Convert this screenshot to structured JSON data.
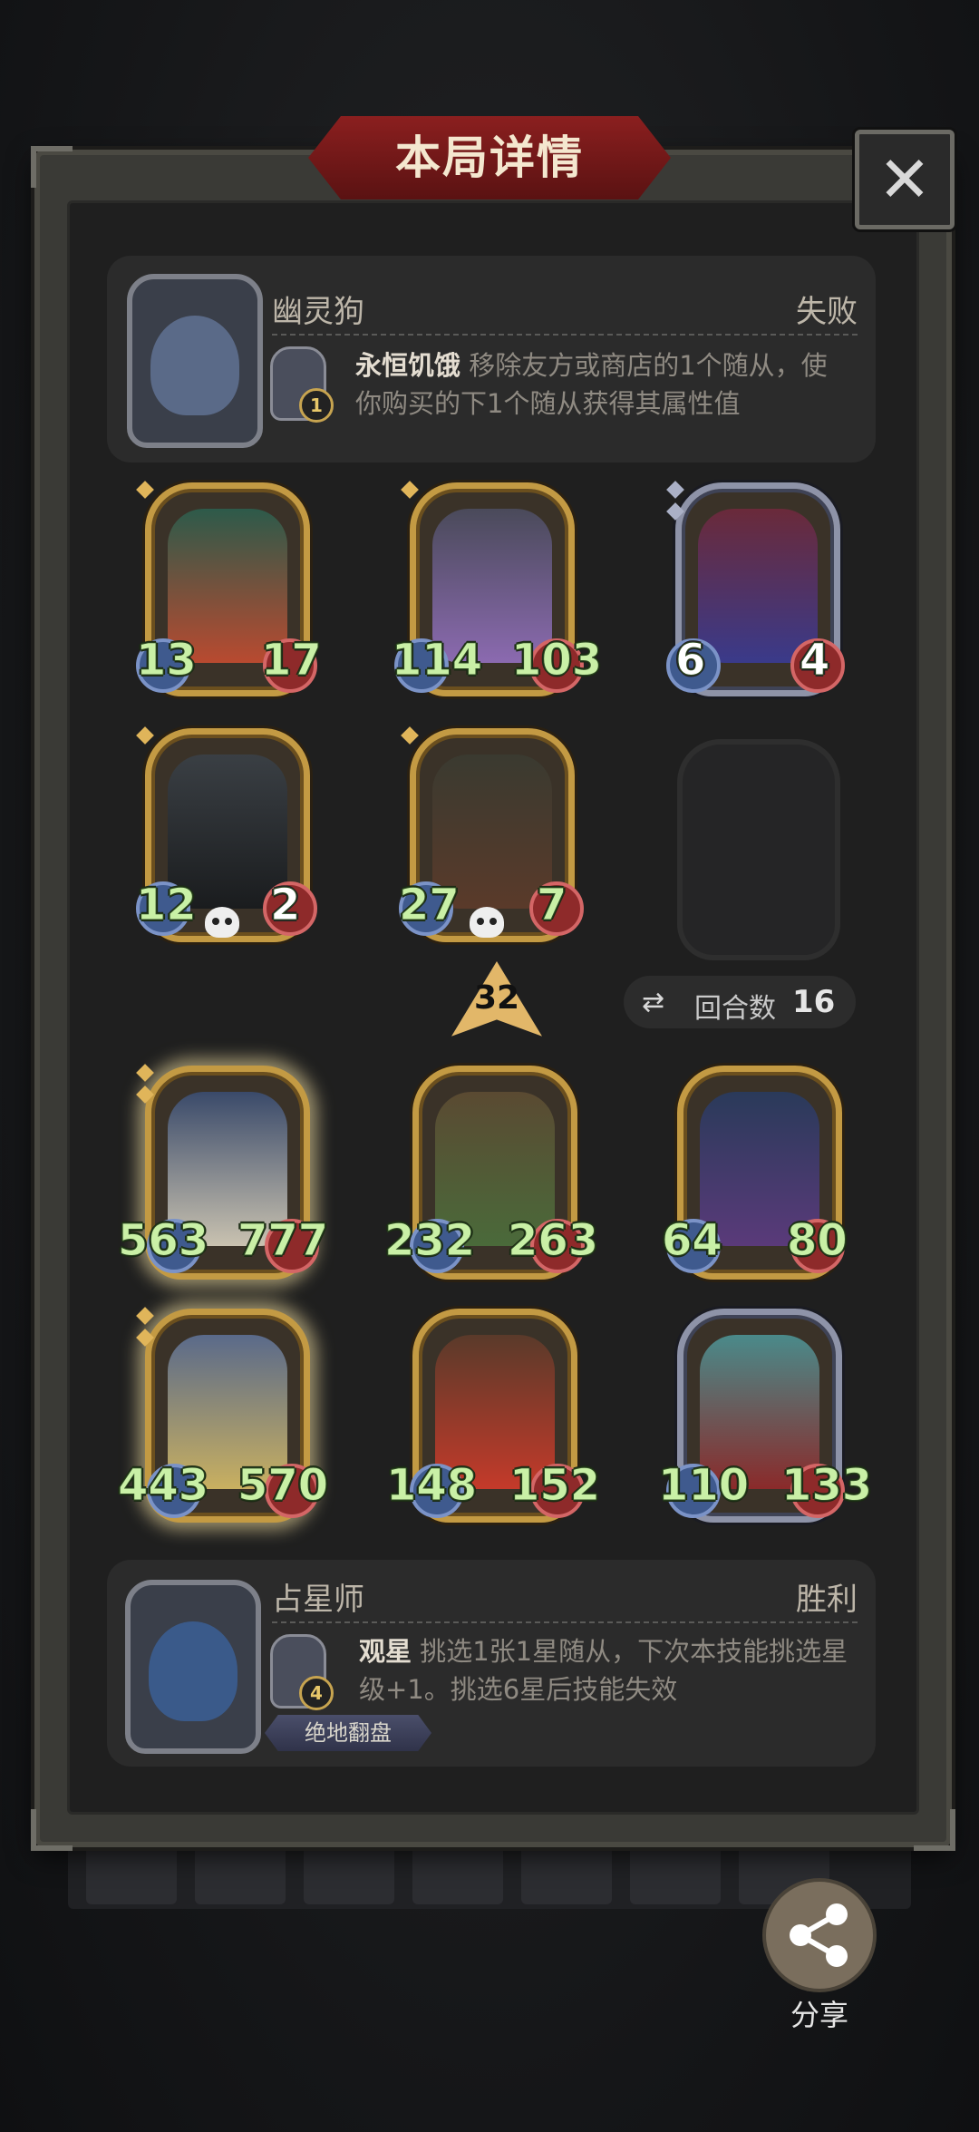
{
  "header": {
    "title": "本局详情",
    "close_icon": "close-icon"
  },
  "opponent": {
    "name": "幽灵狗",
    "result": "失败",
    "skill_level": "1",
    "skill_name": "永恒饥饿",
    "skill_desc_line1": " 移除友方或商店的1个随从，使",
    "skill_desc_line2": "你购买的下1个随从获得其属性值"
  },
  "opponent_board": [
    {
      "attack": "13",
      "health": "17",
      "frame": "gold",
      "dead": false
    },
    {
      "attack": "114",
      "health": "103",
      "frame": "gold",
      "dead": false
    },
    {
      "attack": "6",
      "health": "4",
      "frame": "silver",
      "dead": false,
      "white_stats": true
    },
    {
      "attack": "12",
      "health": "2",
      "frame": "gold",
      "dead": true
    },
    {
      "attack": "27",
      "health": "7",
      "frame": "gold",
      "dead": true
    }
  ],
  "tier": {
    "value": "32"
  },
  "rounds": {
    "label": "回合数",
    "value": "16",
    "icon": "refresh-icon"
  },
  "player_board": [
    {
      "attack": "563",
      "health": "777",
      "frame": "gold",
      "glow": true
    },
    {
      "attack": "232",
      "health": "263",
      "frame": "gold",
      "glow": false
    },
    {
      "attack": "64",
      "health": "80",
      "frame": "gold",
      "glow": false
    },
    {
      "attack": "443",
      "health": "570",
      "frame": "gold",
      "glow": true
    },
    {
      "attack": "148",
      "health": "152",
      "frame": "gold",
      "glow": false
    },
    {
      "attack": "110",
      "health": "133",
      "frame": "silver",
      "glow": false
    }
  ],
  "player": {
    "name": "占星师",
    "result": "胜利",
    "skill_level": "4",
    "skill_name": "观星",
    "skill_desc_line1": " 挑选1张1星随从，下次本技能挑选星",
    "skill_desc_line2": "级+1。挑选6星后技能失效",
    "badge": "绝地翻盘"
  },
  "share": {
    "label": "分享",
    "icon": "share-icon"
  },
  "colors": {
    "gold_frame": "#c39a43",
    "silver_frame": "#8e93a8",
    "stat_green": "#c9f0a6",
    "title_red": "#8b1f1f"
  }
}
